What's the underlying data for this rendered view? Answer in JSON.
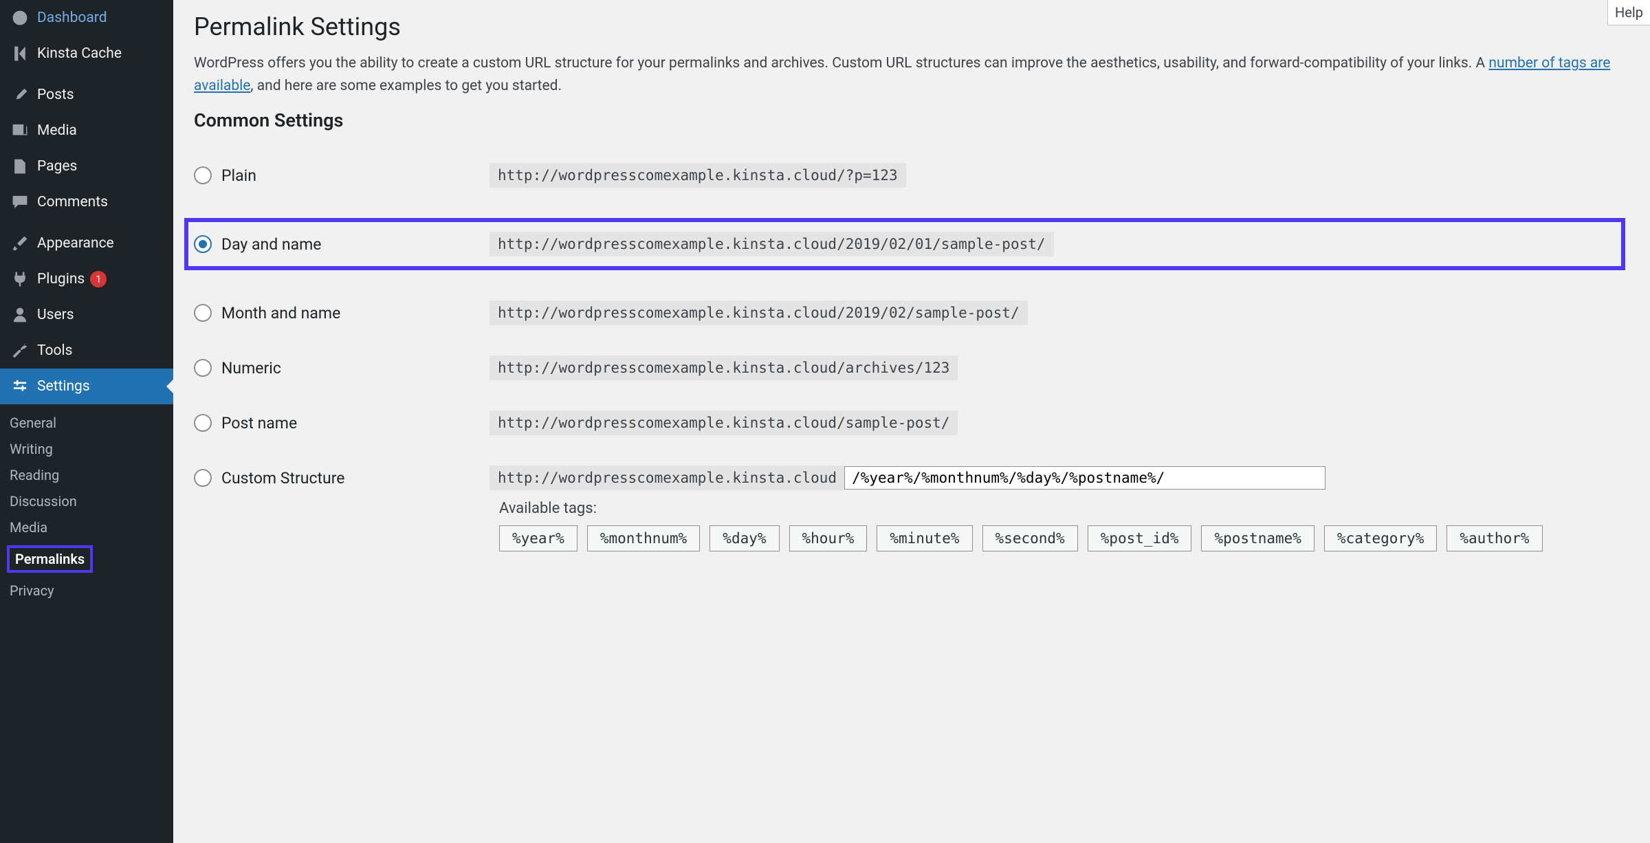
{
  "help_tab": "Help",
  "sidebar": {
    "items": [
      {
        "label": "Dashboard"
      },
      {
        "label": "Kinsta Cache"
      },
      {
        "label": "Posts"
      },
      {
        "label": "Media"
      },
      {
        "label": "Pages"
      },
      {
        "label": "Comments"
      },
      {
        "label": "Appearance"
      },
      {
        "label": "Plugins",
        "badge": "1"
      },
      {
        "label": "Users"
      },
      {
        "label": "Tools"
      },
      {
        "label": "Settings"
      }
    ],
    "submenu": [
      "General",
      "Writing",
      "Reading",
      "Discussion",
      "Media",
      "Permalinks",
      "Privacy"
    ]
  },
  "page": {
    "title": "Permalink Settings",
    "desc_1": "WordPress offers you the ability to create a custom URL structure for your permalinks and archives. Custom URL structures can improve the aesthetics, usability, and forward-compatibility of your links. A ",
    "desc_link": "number of tags are available",
    "desc_2": ", and here are some examples to get you started.",
    "section": "Common Settings",
    "options": {
      "plain": {
        "label": "Plain",
        "code": "http://wordpresscomexample.kinsta.cloud/?p=123"
      },
      "day": {
        "label": "Day and name",
        "code": "http://wordpresscomexample.kinsta.cloud/2019/02/01/sample-post/"
      },
      "month": {
        "label": "Month and name",
        "code": "http://wordpresscomexample.kinsta.cloud/2019/02/sample-post/"
      },
      "numeric": {
        "label": "Numeric",
        "code": "http://wordpresscomexample.kinsta.cloud/archives/123"
      },
      "post": {
        "label": "Post name",
        "code": "http://wordpresscomexample.kinsta.cloud/sample-post/"
      },
      "custom": {
        "label": "Custom Structure",
        "base": "http://wordpresscomexample.kinsta.cloud",
        "value": "/%year%/%monthnum%/%day%/%postname%/"
      }
    },
    "available_label": "Available tags:",
    "tags": [
      "%year%",
      "%monthnum%",
      "%day%",
      "%hour%",
      "%minute%",
      "%second%",
      "%post_id%",
      "%postname%",
      "%category%",
      "%author%"
    ]
  }
}
